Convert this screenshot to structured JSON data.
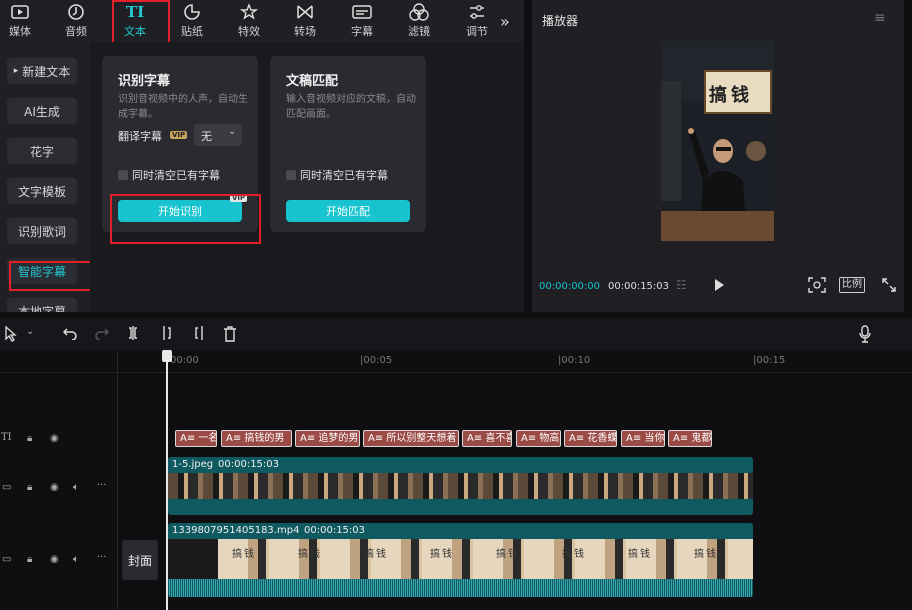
{
  "toolbar": {
    "items": [
      {
        "label": "媒体",
        "icon": "media-icon"
      },
      {
        "label": "音频",
        "icon": "audio-icon"
      },
      {
        "label": "文本",
        "icon": "text-icon",
        "active": true
      },
      {
        "label": "贴纸",
        "icon": "sticker-icon"
      },
      {
        "label": "特效",
        "icon": "effects-icon"
      },
      {
        "label": "转场",
        "icon": "transition-icon"
      },
      {
        "label": "字幕",
        "icon": "subtitle-icon"
      },
      {
        "label": "滤镜",
        "icon": "filter-icon"
      },
      {
        "label": "调节",
        "icon": "adjust-icon"
      }
    ],
    "more_icon": "double-chevron-right-icon"
  },
  "sidebar": {
    "items": [
      {
        "label": "新建文本",
        "arrow": "▸"
      },
      {
        "label": "AI生成"
      },
      {
        "label": "花字"
      },
      {
        "label": "文字模板"
      },
      {
        "label": "识别歌词"
      },
      {
        "label": "智能字幕",
        "active": true
      },
      {
        "label": "本地字幕"
      }
    ]
  },
  "cards": {
    "recognize": {
      "title": "识别字幕",
      "desc": "识别音视频中的人声，自动生成字幕。",
      "translate_label": "翻译字幕",
      "vip_badge": "VIP",
      "translate_value": "无",
      "checkbox_label": "同时清空已有字幕",
      "button_label": "开始识别",
      "button_vip": "VIP"
    },
    "match": {
      "title": "文稿匹配",
      "desc": "输入音视频对应的文稿，自动匹配画面。",
      "checkbox_label": "同时清空已有字幕",
      "button_label": "开始匹配"
    }
  },
  "player": {
    "title": "播放器",
    "current_time": "00:00:00:00",
    "total_time": "00:00:15:03",
    "ratio_label": "比例",
    "sign_text": "搞钱"
  },
  "timeline": {
    "ruler": [
      "00:00",
      "|00:05",
      "|00:10",
      "|00:15"
    ],
    "captions": [
      "一名",
      "搞钱的男",
      "追梦的男",
      "所以别整天想着",
      "喜不喜",
      "物高",
      "花香蝶",
      "当你",
      "鬼都"
    ],
    "caption_prefix": "A≡",
    "track1": {
      "name": "1-5.jpeg",
      "duration": "00:00:15:03"
    },
    "track2": {
      "name": "13398079514051​83.mp4",
      "duration": "00:00:15:03",
      "cover_label": "封面"
    },
    "frame_sign": "搞钱"
  },
  "colors": {
    "accent": "#16c3cf",
    "highlight": "#e0202a",
    "caption": "#9b4b45",
    "clip": "#0f5a60"
  }
}
